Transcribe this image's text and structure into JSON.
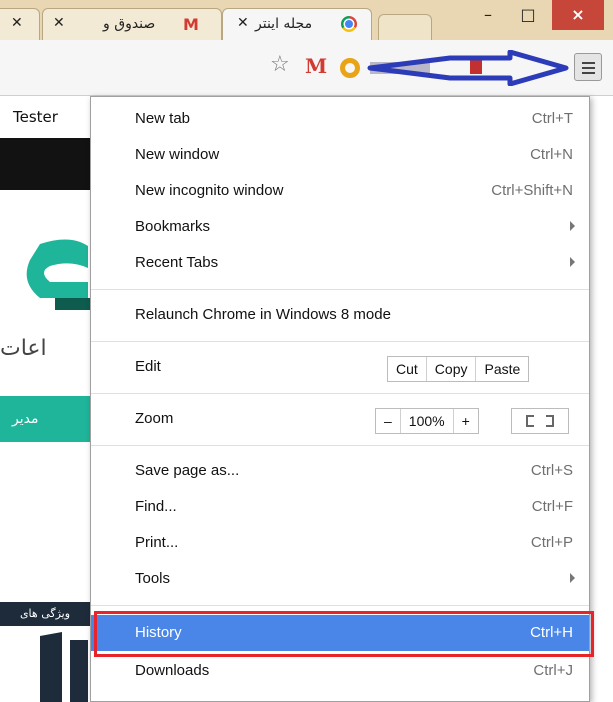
{
  "window": {
    "tabs": [
      {
        "label": "صندوق و",
        "icon": "gmail-icon"
      },
      {
        "label": "مجله اینتر",
        "icon": "chrome-icon"
      },
      {
        "label": ""
      }
    ],
    "controls": {
      "minimize": "–",
      "maximize": "□",
      "close": "×"
    }
  },
  "page": {
    "link_text": "Tester",
    "teal_button": "مدیر",
    "partial_text": "اعات",
    "dark_band": "ویژگی های"
  },
  "menu": {
    "items": [
      {
        "label": "New tab",
        "shortcut": "Ctrl+T"
      },
      {
        "label": "New window",
        "shortcut": "Ctrl+N"
      },
      {
        "label": "New incognito window",
        "shortcut": "Ctrl+Shift+N"
      },
      {
        "label": "Bookmarks",
        "shortcut": ""
      },
      {
        "label": "Recent Tabs",
        "shortcut": ""
      },
      {
        "label": "Relaunch Chrome in Windows 8 mode",
        "shortcut": ""
      },
      {
        "label": "Edit",
        "shortcut": ""
      },
      {
        "label": "Zoom",
        "shortcut": ""
      },
      {
        "label": "Save page as...",
        "shortcut": "Ctrl+S"
      },
      {
        "label": "Find...",
        "shortcut": "Ctrl+F"
      },
      {
        "label": "Print...",
        "shortcut": "Ctrl+P"
      },
      {
        "label": "Tools",
        "shortcut": ""
      },
      {
        "label": "History",
        "shortcut": "Ctrl+H"
      },
      {
        "label": "Downloads",
        "shortcut": "Ctrl+J"
      }
    ],
    "edit_buttons": {
      "cut": "Cut",
      "copy": "Copy",
      "paste": "Paste"
    },
    "zoom": {
      "minus": "–",
      "level": "100%",
      "plus": "+"
    },
    "highlight_color": "#4a86e8",
    "annotation_box_color": "#e8232a",
    "annotation_arrow_color": "#2c3bb8"
  }
}
